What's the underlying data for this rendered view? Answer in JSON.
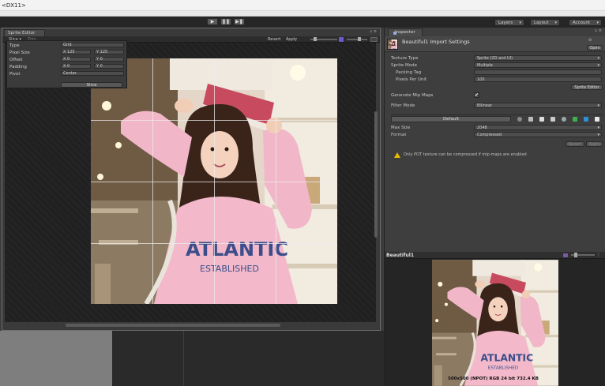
{
  "os": {
    "title": "<DX11>"
  },
  "toolbar": {
    "play": "▶",
    "pause": "❚❚",
    "step": "▶❚",
    "layers": "Layers",
    "layout": "Layout",
    "account": "Account"
  },
  "sprite_editor": {
    "tab": "Sprite Editor",
    "slice_menu": "Slice ▾",
    "trim": "Trim",
    "revert": "Revert",
    "apply": "Apply",
    "slice_popup": {
      "type_label": "Type",
      "type_value": "Grid",
      "pixel_size_label": "Pixel Size",
      "px_x": "X 125",
      "px_y": "Y 125",
      "offset_label": "Offset",
      "off_x": "X 0",
      "off_y": "Y 0",
      "padding_label": "Padding",
      "pad_x": "X 0",
      "pad_y": "Y 0",
      "pivot_label": "Pivot",
      "pivot_value": "Center",
      "slice_button": "Slice"
    }
  },
  "inspector": {
    "tab": "Inspector",
    "title": "Beautiful1 Import Settings",
    "open": "Open",
    "texture_type_label": "Texture Type",
    "texture_type_value": "Sprite (2D and UI)",
    "sprite_mode_label": "Sprite Mode",
    "sprite_mode_value": "Multiple",
    "packing_tag_label": "Packing Tag",
    "packing_tag_value": "",
    "ppu_label": "Pixels Per Unit",
    "ppu_value": "100",
    "sprite_editor_btn": "Sprite Editor",
    "mipmaps_label": "Generate Mip Maps",
    "mipmaps_check": "✔",
    "filter_label": "Filter Mode",
    "filter_value": "Bilinear",
    "default_tab": "Default",
    "max_size_label": "Max Size",
    "max_size_value": "2048",
    "format_label": "Format",
    "format_value": "Compressed",
    "revert": "Revert",
    "apply": "Apply",
    "warning": "Only POT texture can be compressed if mip-maps are enabled"
  },
  "preview": {
    "title": "Beautiful1",
    "info": "500x500 (NPOT)  RGB 24 bit  732.4 KB"
  },
  "colors": {
    "accent": "#3e6bb0",
    "warning": "#e6b800",
    "panel": "#3e3e3e"
  }
}
